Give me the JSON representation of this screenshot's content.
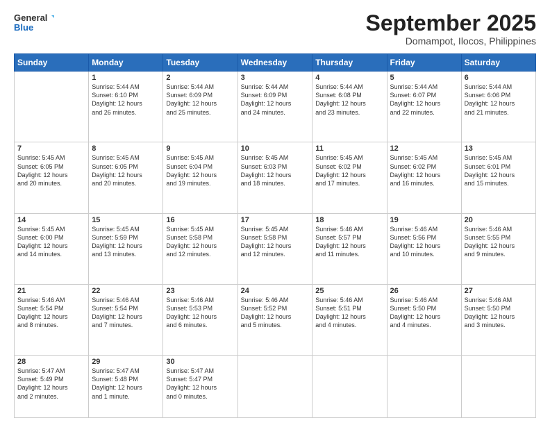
{
  "header": {
    "logo_line1": "General",
    "logo_line2": "Blue",
    "month": "September 2025",
    "location": "Domampot, Ilocos, Philippines"
  },
  "days_of_week": [
    "Sunday",
    "Monday",
    "Tuesday",
    "Wednesday",
    "Thursday",
    "Friday",
    "Saturday"
  ],
  "weeks": [
    [
      {
        "day": "",
        "text": ""
      },
      {
        "day": "1",
        "text": "Sunrise: 5:44 AM\nSunset: 6:10 PM\nDaylight: 12 hours\nand 26 minutes."
      },
      {
        "day": "2",
        "text": "Sunrise: 5:44 AM\nSunset: 6:09 PM\nDaylight: 12 hours\nand 25 minutes."
      },
      {
        "day": "3",
        "text": "Sunrise: 5:44 AM\nSunset: 6:09 PM\nDaylight: 12 hours\nand 24 minutes."
      },
      {
        "day": "4",
        "text": "Sunrise: 5:44 AM\nSunset: 6:08 PM\nDaylight: 12 hours\nand 23 minutes."
      },
      {
        "day": "5",
        "text": "Sunrise: 5:44 AM\nSunset: 6:07 PM\nDaylight: 12 hours\nand 22 minutes."
      },
      {
        "day": "6",
        "text": "Sunrise: 5:44 AM\nSunset: 6:06 PM\nDaylight: 12 hours\nand 21 minutes."
      }
    ],
    [
      {
        "day": "7",
        "text": "Sunrise: 5:45 AM\nSunset: 6:05 PM\nDaylight: 12 hours\nand 20 minutes."
      },
      {
        "day": "8",
        "text": "Sunrise: 5:45 AM\nSunset: 6:05 PM\nDaylight: 12 hours\nand 20 minutes."
      },
      {
        "day": "9",
        "text": "Sunrise: 5:45 AM\nSunset: 6:04 PM\nDaylight: 12 hours\nand 19 minutes."
      },
      {
        "day": "10",
        "text": "Sunrise: 5:45 AM\nSunset: 6:03 PM\nDaylight: 12 hours\nand 18 minutes."
      },
      {
        "day": "11",
        "text": "Sunrise: 5:45 AM\nSunset: 6:02 PM\nDaylight: 12 hours\nand 17 minutes."
      },
      {
        "day": "12",
        "text": "Sunrise: 5:45 AM\nSunset: 6:02 PM\nDaylight: 12 hours\nand 16 minutes."
      },
      {
        "day": "13",
        "text": "Sunrise: 5:45 AM\nSunset: 6:01 PM\nDaylight: 12 hours\nand 15 minutes."
      }
    ],
    [
      {
        "day": "14",
        "text": "Sunrise: 5:45 AM\nSunset: 6:00 PM\nDaylight: 12 hours\nand 14 minutes."
      },
      {
        "day": "15",
        "text": "Sunrise: 5:45 AM\nSunset: 5:59 PM\nDaylight: 12 hours\nand 13 minutes."
      },
      {
        "day": "16",
        "text": "Sunrise: 5:45 AM\nSunset: 5:58 PM\nDaylight: 12 hours\nand 12 minutes."
      },
      {
        "day": "17",
        "text": "Sunrise: 5:45 AM\nSunset: 5:58 PM\nDaylight: 12 hours\nand 12 minutes."
      },
      {
        "day": "18",
        "text": "Sunrise: 5:46 AM\nSunset: 5:57 PM\nDaylight: 12 hours\nand 11 minutes."
      },
      {
        "day": "19",
        "text": "Sunrise: 5:46 AM\nSunset: 5:56 PM\nDaylight: 12 hours\nand 10 minutes."
      },
      {
        "day": "20",
        "text": "Sunrise: 5:46 AM\nSunset: 5:55 PM\nDaylight: 12 hours\nand 9 minutes."
      }
    ],
    [
      {
        "day": "21",
        "text": "Sunrise: 5:46 AM\nSunset: 5:54 PM\nDaylight: 12 hours\nand 8 minutes."
      },
      {
        "day": "22",
        "text": "Sunrise: 5:46 AM\nSunset: 5:54 PM\nDaylight: 12 hours\nand 7 minutes."
      },
      {
        "day": "23",
        "text": "Sunrise: 5:46 AM\nSunset: 5:53 PM\nDaylight: 12 hours\nand 6 minutes."
      },
      {
        "day": "24",
        "text": "Sunrise: 5:46 AM\nSunset: 5:52 PM\nDaylight: 12 hours\nand 5 minutes."
      },
      {
        "day": "25",
        "text": "Sunrise: 5:46 AM\nSunset: 5:51 PM\nDaylight: 12 hours\nand 4 minutes."
      },
      {
        "day": "26",
        "text": "Sunrise: 5:46 AM\nSunset: 5:50 PM\nDaylight: 12 hours\nand 4 minutes."
      },
      {
        "day": "27",
        "text": "Sunrise: 5:46 AM\nSunset: 5:50 PM\nDaylight: 12 hours\nand 3 minutes."
      }
    ],
    [
      {
        "day": "28",
        "text": "Sunrise: 5:47 AM\nSunset: 5:49 PM\nDaylight: 12 hours\nand 2 minutes."
      },
      {
        "day": "29",
        "text": "Sunrise: 5:47 AM\nSunset: 5:48 PM\nDaylight: 12 hours\nand 1 minute."
      },
      {
        "day": "30",
        "text": "Sunrise: 5:47 AM\nSunset: 5:47 PM\nDaylight: 12 hours\nand 0 minutes."
      },
      {
        "day": "",
        "text": ""
      },
      {
        "day": "",
        "text": ""
      },
      {
        "day": "",
        "text": ""
      },
      {
        "day": "",
        "text": ""
      }
    ]
  ]
}
